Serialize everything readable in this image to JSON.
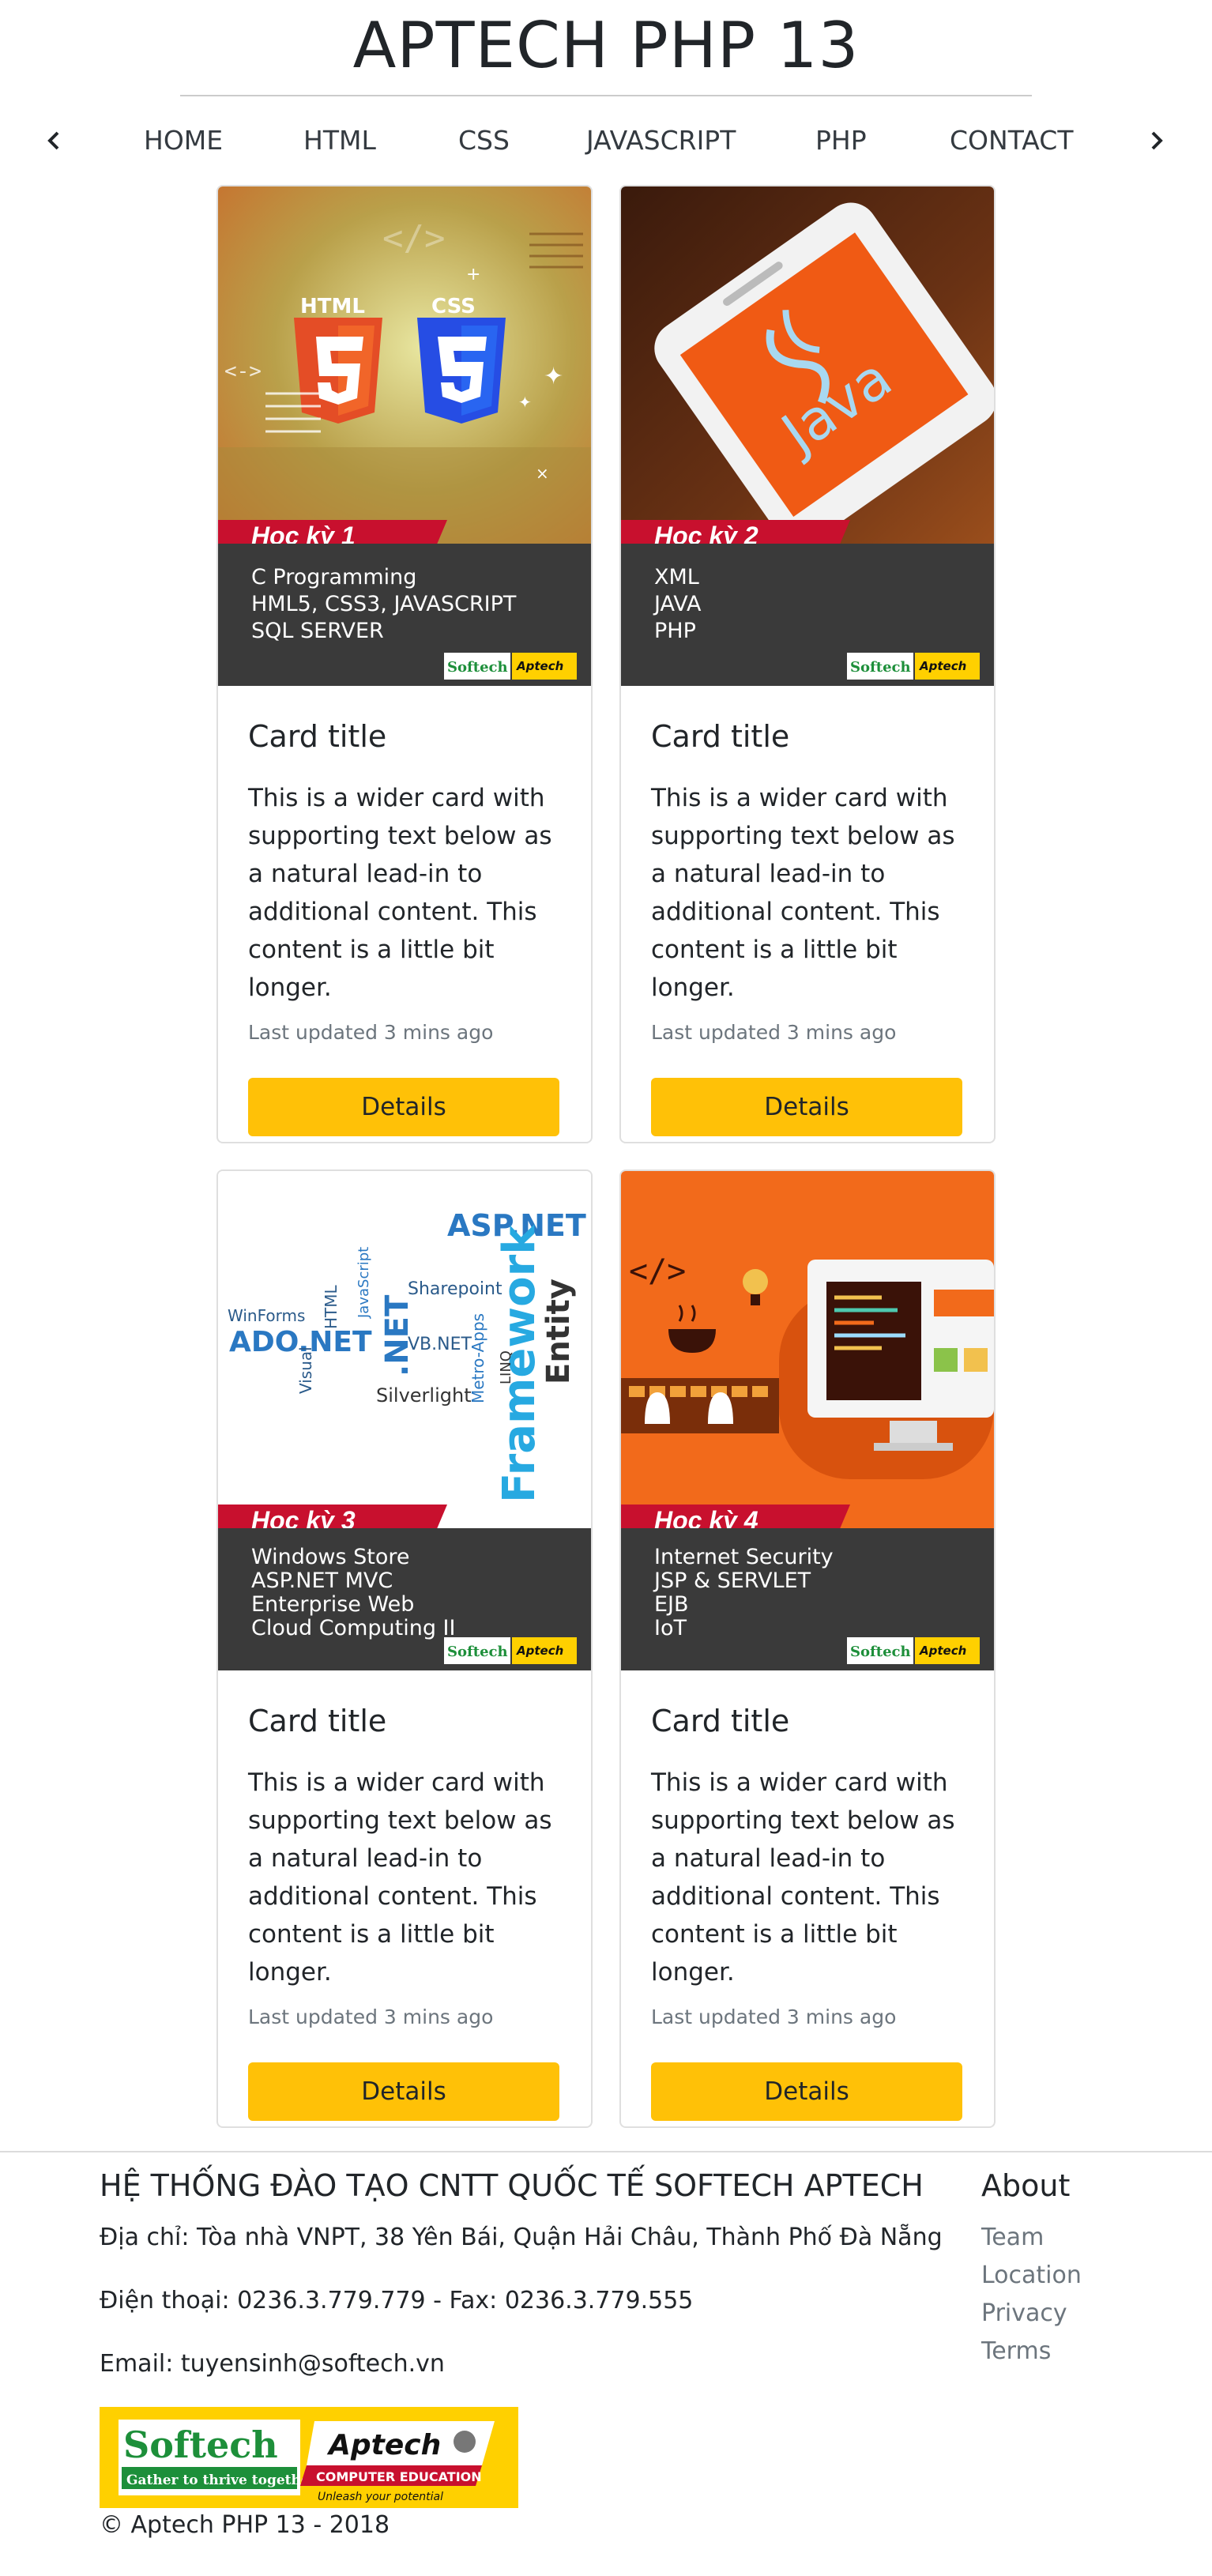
{
  "site": {
    "title": "APTECH PHP 13"
  },
  "nav": {
    "items": [
      "HOME",
      "HTML",
      "CSS",
      "JAVASCRIPT",
      "PHP",
      "CONTACT"
    ],
    "prev_icon": "chevron-left-icon",
    "next_icon": "chevron-right-icon"
  },
  "cards": [
    {
      "semester": "Học kỳ 1",
      "subjects": [
        "C Programming",
        "HML5, CSS3, JAVASCRIPT",
        "SQL SERVER"
      ],
      "logo_softech": "Softech",
      "logo_aptech": "Aptech",
      "title": "Card title",
      "text": "This is a wider card with supporting text below as a natural lead-in to additional content. This content is a little bit longer.",
      "updated": "Last updated 3 mins ago",
      "button": "Details"
    },
    {
      "semester": "Học kỳ 2",
      "subjects": [
        "XML",
        "JAVA",
        "PHP"
      ],
      "screen_text": "Java",
      "logo_softech": "Softech",
      "logo_aptech": "Aptech",
      "title": "Card title",
      "text": "This is a wider card with supporting text below as a natural lead-in to additional content. This content is a little bit longer.",
      "updated": "Last updated 3 mins ago",
      "button": "Details"
    },
    {
      "semester": "Học kỳ 3",
      "subjects": [
        "Windows Store",
        "ASP.NET MVC",
        "Enterprise Web",
        "Cloud Computing II"
      ],
      "logo_softech": "Softech",
      "logo_aptech": "Aptech",
      "title": "Card title",
      "text": "This is a wider card with supporting text below as a natural lead-in to additional content. This content is a little bit longer.",
      "updated": "Last updated 3 mins ago",
      "button": "Details"
    },
    {
      "semester": "Học kỳ 4",
      "subjects": [
        "Internet Security",
        "JSP & SERVLET",
        "EJB",
        "IoT"
      ],
      "logo_softech": "Softech",
      "logo_aptech": "Aptech",
      "title": "Card title",
      "text": "This is a wider card with supporting text below as a natural lead-in to additional content. This content is a little bit longer.",
      "updated": "Last updated 3 mins ago",
      "button": "Details"
    }
  ],
  "footer": {
    "heading": "HỆ THỐNG ĐÀO TẠO CNTT QUỐC TẾ SOFTECH APTECH",
    "address": "Địa chỉ: Tòa nhà VNPT, 38 Yên Bái, Quận Hải Châu, Thành Phố Đà Nẵng",
    "phone": "Điện thoại: 0236.3.779.779 - Fax: 0236.3.779.555",
    "email": "Email: tuyensinh@softech.vn",
    "logo": {
      "softech": "Softech",
      "softech_tagline": "Gather to thrive together",
      "aptech": "Aptech",
      "aptech_sub": "COMPUTER EDUCATION",
      "aptech_tagline": "Unleash your potential"
    },
    "copyright": "© Aptech PHP 13 - 2018",
    "about": {
      "heading": "About",
      "links": [
        "Team",
        "Location",
        "Privacy",
        "Terms"
      ]
    }
  },
  "colors": {
    "button": "#ffc107",
    "semester_band": "#c8102e",
    "panel": "#3a3a3a"
  }
}
